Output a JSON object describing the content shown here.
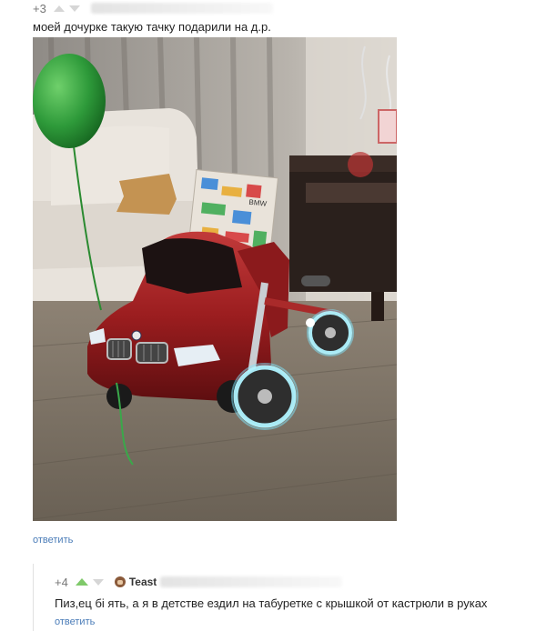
{
  "comment1": {
    "rating": "+3",
    "text": "моей дочурке такую тачку подарили на д.р.",
    "reply": "ответить"
  },
  "comment2": {
    "rating": "+4",
    "username": "Teast",
    "text": "Пиз,ец бі ять, а я в детстве ездил на табуретке с крышкой от кастрюли в руках",
    "reply": "ответить"
  },
  "photo": {
    "car_color": "#9b1d1f",
    "balloon_color": "#2e9a3a",
    "wheel_glow_color": "#aff3ff",
    "gift_label": "BMW"
  }
}
